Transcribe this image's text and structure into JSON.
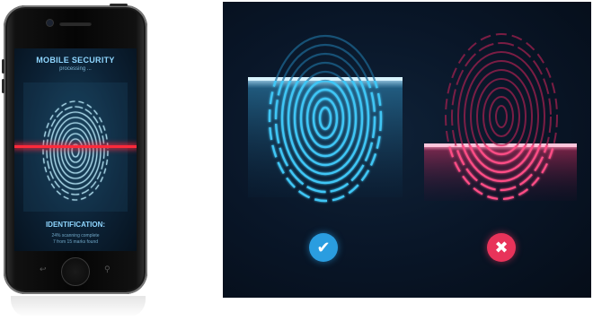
{
  "phone": {
    "screen_title": "MOBILE SECURITY",
    "screen_subtitle": "processing ...",
    "identification_title": "IDENTIFICATION:",
    "identification_lines": [
      "24% scanning complete",
      "7 from 15 marks found"
    ],
    "scan_line_color": "#ff2a3a"
  },
  "panel": {
    "accepted_icon": "check-icon",
    "rejected_icon": "close-icon",
    "accepted_glyph": "✔",
    "rejected_glyph": "✖",
    "accepted_color": "#2a9de0",
    "rejected_color": "#e8335a"
  }
}
